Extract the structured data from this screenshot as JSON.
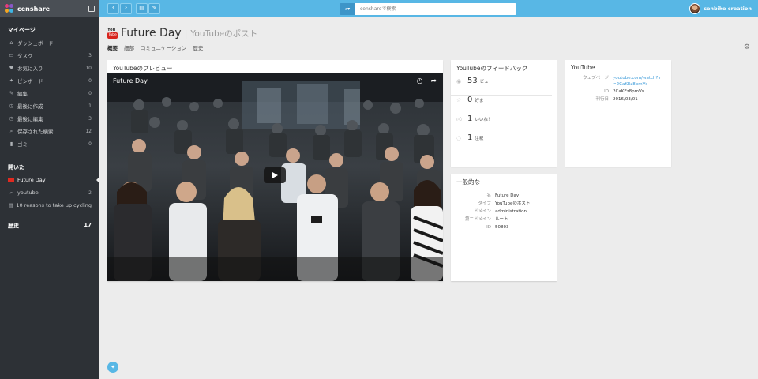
{
  "brand": {
    "name": "censhare"
  },
  "topbar": {
    "back_icon": "chevron-left-icon",
    "forward_icon": "chevron-right-icon",
    "search_type_icon": "search-icon",
    "search_placeholder": "censhareで検索",
    "user_name": "cenbike creation"
  },
  "sidebar": {
    "my_page_title": "マイページ",
    "my_page_items": [
      {
        "label": "ダッシュボード",
        "count": "",
        "icon": "home-icon"
      },
      {
        "label": "タスク",
        "count": "3",
        "icon": "inbox-icon"
      },
      {
        "label": "お気に入り",
        "count": "10",
        "icon": "heart-icon"
      },
      {
        "label": "ピンボード",
        "count": "0",
        "icon": "pin-icon"
      },
      {
        "label": "編集",
        "count": "0",
        "icon": "pencil-icon"
      },
      {
        "label": "最後に作成",
        "count": "1",
        "icon": "clock-icon"
      },
      {
        "label": "最後に編集",
        "count": "3",
        "icon": "clock-icon"
      },
      {
        "label": "保存された検索",
        "count": "12",
        "icon": "search-icon"
      },
      {
        "label": "ゴミ",
        "count": "0",
        "icon": "trash-icon"
      }
    ],
    "opened_title": "開いた",
    "opened_items": [
      {
        "label": "Future Day",
        "count": "",
        "icon": "youtube-icon"
      },
      {
        "label": "youtube",
        "count": "2",
        "icon": "search-icon"
      },
      {
        "label": "10 reasons to take up cycling",
        "count": "",
        "icon": "document-icon"
      }
    ],
    "history_title": "歴史",
    "history_count": "17"
  },
  "header": {
    "logo_top": "You",
    "logo_bottom": "Tube",
    "title": "Future Day",
    "subtitle": "YouTubeのポスト",
    "tabs": [
      "概要",
      "細部",
      "コミュニケーション",
      "歴史"
    ]
  },
  "preview": {
    "title": "YouTubeのプレビュー",
    "video_title": "Future Day"
  },
  "feedback": {
    "title": "YouTubeのフィードバック",
    "rows": [
      {
        "value": "53",
        "unit": "ビュー",
        "icon": "eye-icon"
      },
      {
        "value": "0",
        "unit": "好ま",
        "icon": "star-icon"
      },
      {
        "value": "1",
        "unit": "いいね！",
        "icon": "thumbs-up-icon"
      },
      {
        "value": "1",
        "unit": "注釈",
        "icon": "comment-icon"
      }
    ]
  },
  "general": {
    "title": "一般的な",
    "fields": [
      {
        "key": "名",
        "value": "Future Day"
      },
      {
        "key": "タイプ",
        "value": "YouTubeのポスト"
      },
      {
        "key": "ドメイン",
        "value": "administration"
      },
      {
        "key": "第二ドメイン",
        "value": "ルート"
      },
      {
        "key": "ID",
        "value": "50803"
      }
    ]
  },
  "youtube": {
    "title": "YouTube",
    "webpage_key": "ウェブページ",
    "webpage_value": "youtube.com/watch?v=2CaKEz8pmVs",
    "id_key": "ID",
    "id_value": "2CaKEz8pmVs",
    "published_key": "刊行日",
    "published_value": "2016/03/01"
  }
}
